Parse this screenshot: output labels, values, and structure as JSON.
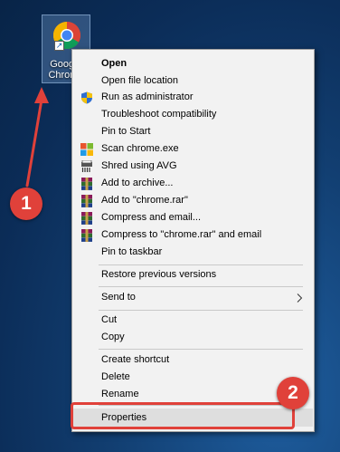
{
  "desktop_icon": {
    "label": "Google\nChrome",
    "icon": "chrome-icon"
  },
  "context_menu": {
    "items": [
      {
        "label": "Open",
        "bold": true
      },
      {
        "label": "Open file location"
      },
      {
        "label": "Run as administrator",
        "icon": "shield-icon"
      },
      {
        "label": "Troubleshoot compatibility"
      },
      {
        "label": "Pin to Start"
      },
      {
        "label": "Scan chrome.exe",
        "icon": "windows-defender-icon"
      },
      {
        "label": "Shred using AVG",
        "icon": "shredder-icon"
      },
      {
        "label": "Add to archive...",
        "icon": "winrar-icon"
      },
      {
        "label": "Add to \"chrome.rar\"",
        "icon": "winrar-icon"
      },
      {
        "label": "Compress and email...",
        "icon": "winrar-icon"
      },
      {
        "label": "Compress to \"chrome.rar\" and email",
        "icon": "winrar-icon"
      },
      {
        "label": "Pin to taskbar"
      },
      {
        "label": "Restore previous versions"
      },
      {
        "label": "Send to",
        "submenu": true
      },
      {
        "label": "Cut"
      },
      {
        "label": "Copy"
      },
      {
        "label": "Create shortcut"
      },
      {
        "label": "Delete"
      },
      {
        "label": "Rename"
      },
      {
        "label": "Properties",
        "highlighted": true
      }
    ]
  },
  "annotations": {
    "step1": "1",
    "step2": "2",
    "color": "#e0413a"
  }
}
